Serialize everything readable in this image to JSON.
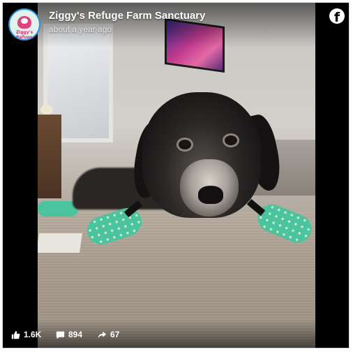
{
  "post": {
    "page_name": "Ziggy's Refuge Farm Sanctuary",
    "posted_time": "about a year ago",
    "avatar_text": "Ziggy's Refuge"
  },
  "stats": {
    "likes": "1.6K",
    "comments": "894",
    "shares": "67"
  },
  "icons": {
    "platform": "facebook-icon",
    "like": "thumbs-up-icon",
    "comment": "comment-icon",
    "share": "share-arrow-icon"
  },
  "colors": {
    "background": "#000000",
    "text": "#ffffff",
    "sock_green": "#4bc39c"
  }
}
